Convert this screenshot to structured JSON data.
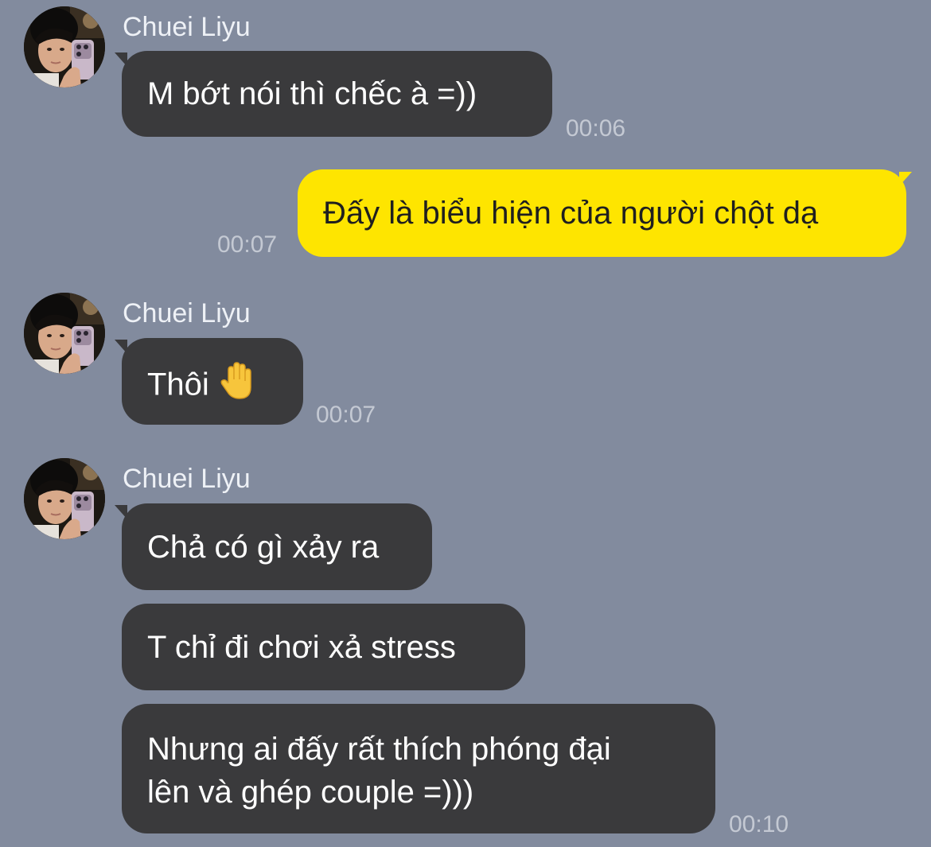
{
  "contact": {
    "name": "Chuei Liyu"
  },
  "messages": [
    {
      "direction": "incoming",
      "sender": "Chuei Liyu",
      "text": "M bớt nói thì chếc à =))",
      "time": "00:06"
    },
    {
      "direction": "outgoing",
      "text": "Đấy là biểu hiện của người chột dạ",
      "time": "00:07"
    },
    {
      "direction": "incoming",
      "sender": "Chuei Liyu",
      "text": "Thôi",
      "emoji": "raised-hand-emoji",
      "time": "00:07"
    },
    {
      "direction": "incoming",
      "sender": "Chuei Liyu",
      "text": "Chả có gì xảy ra"
    },
    {
      "direction": "incoming",
      "text": "T chỉ đi chơi xả stress"
    },
    {
      "direction": "incoming",
      "lines": [
        "Nhưng ai đấy rất thích phóng đại",
        "lên và ghép couple =)))"
      ],
      "time": "00:10"
    }
  ],
  "colors": {
    "background": "#828b9e",
    "incoming_bubble": "#3a3a3c",
    "outgoing_bubble": "#fee500",
    "incoming_text": "#ffffff",
    "outgoing_text": "#1f1f1f",
    "timestamp": "#c4c9d3"
  }
}
